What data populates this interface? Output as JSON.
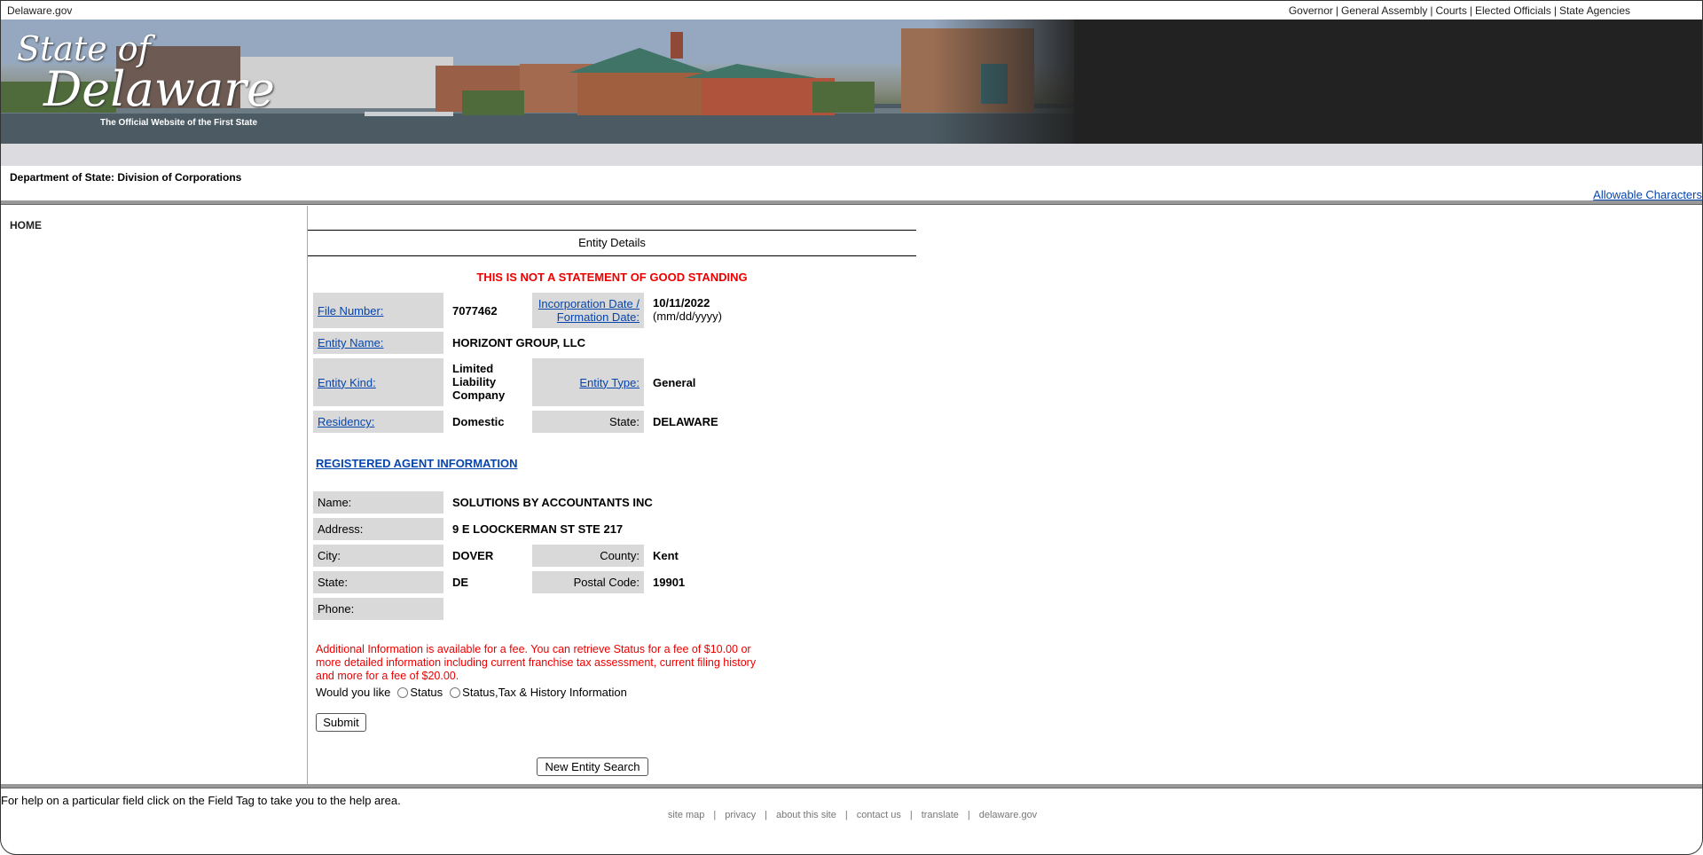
{
  "topbar": {
    "site": "Delaware.gov",
    "links": [
      "Governor",
      "General Assembly",
      "Courts",
      "Elected Officials",
      "State Agencies"
    ]
  },
  "banner": {
    "logo_line1": "State of",
    "logo_line2": "Delaware",
    "tagline": "The Official Website of the First State"
  },
  "dept_title": "Department of State: Division of Corporations",
  "allowable_link": "Allowable Characters",
  "sidebar": {
    "home": "HOME"
  },
  "entity": {
    "title": "Entity Details",
    "warning": "THIS IS NOT A STATEMENT OF GOOD STANDING",
    "file_number_label": "File Number:",
    "file_number": "7077462",
    "inc_date_label_1": "Incorporation Date /",
    "inc_date_label_2": "Formation Date:",
    "inc_date": "10/11/2022",
    "inc_date_format": "(mm/dd/yyyy)",
    "entity_name_label": "Entity Name:",
    "entity_name": "HORIZONT GROUP, LLC",
    "entity_kind_label": "Entity Kind:",
    "entity_kind_1": "Limited",
    "entity_kind_2": "Liability",
    "entity_kind_3": "Company",
    "entity_type_label": "Entity Type:",
    "entity_type": "General",
    "residency_label": "Residency:",
    "residency": "Domestic",
    "state_label": "State:",
    "state": "DELAWARE"
  },
  "agent": {
    "header": "REGISTERED AGENT INFORMATION",
    "name_label": "Name:",
    "name": "SOLUTIONS BY ACCOUNTANTS INC",
    "address_label": "Address:",
    "address": "9 E LOOCKERMAN ST STE 217",
    "city_label": "City:",
    "city": "DOVER",
    "county_label": "County:",
    "county": "Kent",
    "state_label": "State:",
    "state": "DE",
    "postal_label": "Postal Code:",
    "postal": "19901",
    "phone_label": "Phone:",
    "phone": ""
  },
  "additional": {
    "line1": "Additional Information is available for a fee. You can retrieve Status for a fee of $10.00 or",
    "line2": "more detailed information including current franchise tax assessment, current filing history",
    "line3": "and more for a fee of $20.00.",
    "would_you_like": "Would you like",
    "option_status": "Status",
    "option_full": "Status,Tax & History Information",
    "submit": "Submit"
  },
  "new_search": "New Entity Search",
  "help_text": "For help on a particular field click on the Field Tag to take you to the help area.",
  "footer_links": [
    "site map",
    "privacy",
    "about this site",
    "contact us",
    "translate",
    "delaware.gov"
  ]
}
